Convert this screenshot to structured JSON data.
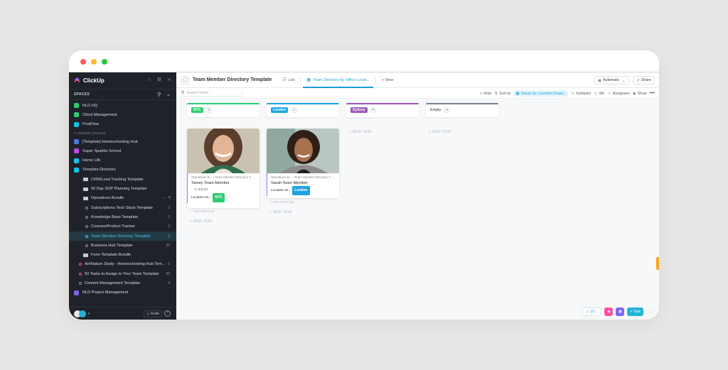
{
  "colors": {
    "bg": "#e7e6e5",
    "accent": "#1a9fd4",
    "nyc": "#2ecc71",
    "london": "#1fa3e0",
    "sydney": "#9b59b6",
    "empty": "#7c838c"
  },
  "sidebar": {
    "logo": "ClickUp",
    "spaces_label": "SPACES",
    "hidden_label": "7 HIDDEN SPACES",
    "invite": "Invite",
    "help": "?",
    "items": [
      {
        "label": "NLD HQ",
        "icon": "space-icon",
        "color": "#2ecc71"
      },
      {
        "label": "Client Management",
        "icon": "space-icon",
        "color": "#2ecc71"
      },
      {
        "label": "PostFlow",
        "icon": "space-icon",
        "color": "#12c2e9"
      },
      {
        "label": "[Template] Homeschooling Hub",
        "icon": "space-icon",
        "color": "#4a7bd9"
      },
      {
        "label": "Super Sparkle School",
        "icon": "space-icon",
        "color": "#c147e9"
      },
      {
        "label": "Home Life",
        "icon": "space-icon",
        "color": "#12c2e9"
      },
      {
        "label": "Template Directory",
        "icon": "space-icon",
        "color": "#12c2e9"
      },
      {
        "label": "CRM/Lead Tracking Template",
        "icon": "folder-icon"
      },
      {
        "label": "90 Day SOP Planning Template",
        "icon": "folder-icon"
      },
      {
        "label": "Operations Bundle",
        "icon": "folder-open-icon"
      },
      {
        "label": "Subscriptions-Tech Stack Template",
        "icon": "list-icon",
        "count": "2"
      },
      {
        "label": "Knowledge Base Template",
        "icon": "list-icon",
        "count": "2"
      },
      {
        "label": "Courses/Product Tracker",
        "icon": "list-icon",
        "count": "2"
      },
      {
        "label": "Team Member Directory Template",
        "icon": "list-icon",
        "count": "2"
      },
      {
        "label": "Business Hub Template",
        "icon": "list-icon",
        "count": "20"
      },
      {
        "label": "Form Template Bundle",
        "icon": "folder-icon"
      },
      {
        "label": "Art/Nature Study - Homeschooling Hub Tem...",
        "icon": "list-icon",
        "count": "6"
      },
      {
        "label": "50 Tasks to Assign to Your Team Template",
        "icon": "list-icon",
        "count": "50"
      },
      {
        "label": "Content Management Template",
        "icon": "list-icon",
        "count": "4"
      },
      {
        "label": "NLD Project Management",
        "icon": "space-icon",
        "color": "#7b68ee"
      }
    ]
  },
  "header": {
    "title": "Team Member Directory Template",
    "tabs": [
      {
        "label": "List"
      },
      {
        "label": "Team Directory by Office Locat..."
      },
      {
        "label": "+ View"
      }
    ],
    "automate": "Automate",
    "share": "Share"
  },
  "toolbar": {
    "search_placeholder": "Search tasks...",
    "filter": "Filter",
    "sort": "Sort by",
    "group": "Group by: Location Dropd...",
    "subtasks": "Subtasks",
    "me": "Me",
    "assignees": "Assignees",
    "show": "Show",
    "more": "•••"
  },
  "board": {
    "new_task": "+ NEW TASK",
    "add_subtask": "+ ADD SUBTASK",
    "columns": [
      {
        "tag": "NYC",
        "count": "1",
        "color": "#2ecc71"
      },
      {
        "tag": "London",
        "count": "1",
        "color": "#1fa3e0"
      },
      {
        "tag": "Sydney",
        "count": "0",
        "color": "#9b59b6"
      },
      {
        "tag": "Empty",
        "count": "0",
        "color": "#7c838c"
      }
    ],
    "cards": [
      {
        "path": "Operations B... › Team Member Directory T...",
        "name": "Tamey Team Member",
        "date": "6/1/23",
        "location_label": "Location Dr...",
        "location_tag": "NYC"
      },
      {
        "path": "Operations B... › Team Member Directory T...",
        "name": "Sarah Team Member",
        "date": "",
        "location_label": "Location Dr...",
        "location_tag": "London"
      }
    ]
  },
  "footer": {
    "assigned": "10",
    "task_btn": "Task"
  }
}
